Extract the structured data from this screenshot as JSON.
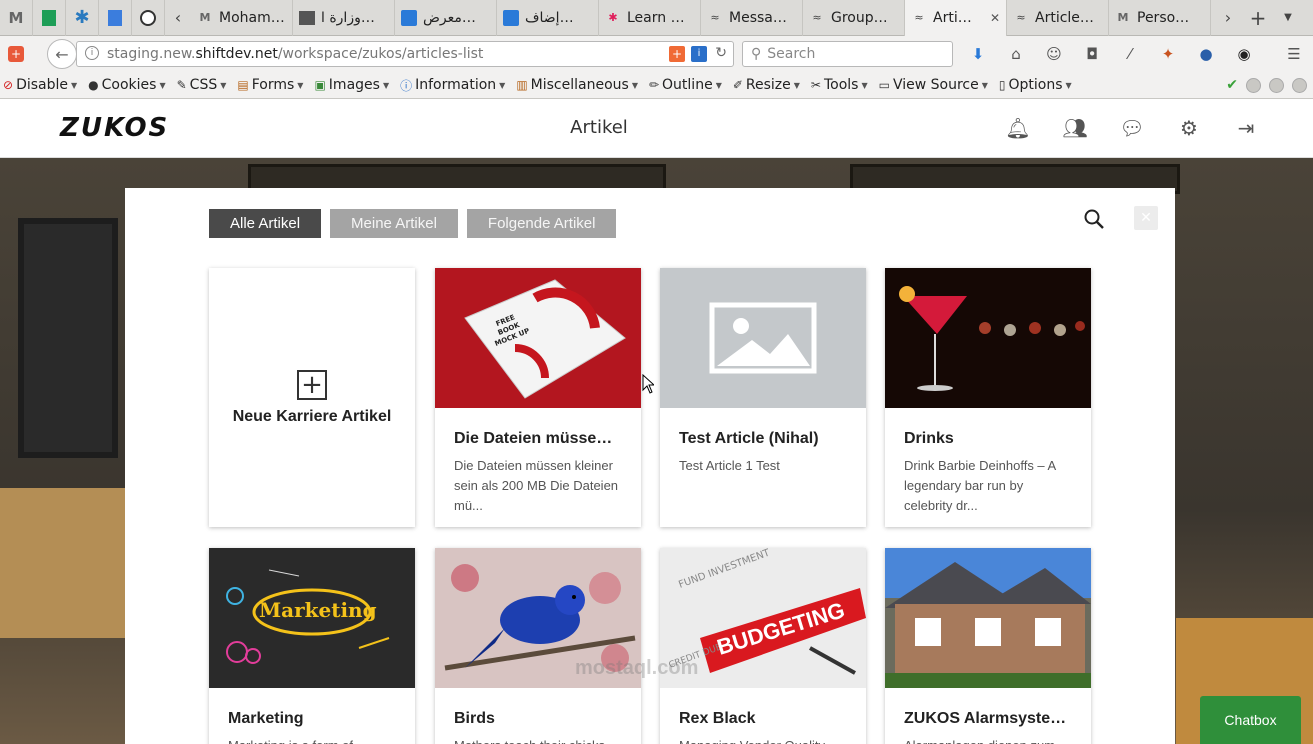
{
  "browser": {
    "tabs": [
      {
        "label": "Mohame…",
        "icon": "gmail-icon",
        "active": false
      },
      {
        "label": "وزارة ا…",
        "icon": "document-icon",
        "active": false
      },
      {
        "label": "معرض…",
        "icon": "mostaql-icon",
        "active": false
      },
      {
        "label": "إضاف…",
        "icon": "mostaql-icon",
        "active": false
      },
      {
        "label": "Learn …",
        "icon": "slack-icon",
        "active": false
      },
      {
        "label": "Messa…",
        "icon": "zukos-icon",
        "active": false
      },
      {
        "label": "Group…",
        "icon": "zukos-icon",
        "active": false
      },
      {
        "label": "Arti…",
        "icon": "zukos-icon",
        "active": true
      },
      {
        "label": "Article…",
        "icon": "zukos-icon",
        "active": false
      },
      {
        "label": "Perso…",
        "icon": "gmail-icon",
        "active": false
      }
    ],
    "url_prefix": "staging.new.",
    "url_domain": "shiftdev.net",
    "url_path": "/workspace/zukos/articles-list",
    "search_placeholder": "Search"
  },
  "devbar": {
    "items": [
      {
        "label": "Disable",
        "icon": "disable-icon"
      },
      {
        "label": "Cookies",
        "icon": "cookies-icon"
      },
      {
        "label": "CSS",
        "icon": "css-icon"
      },
      {
        "label": "Forms",
        "icon": "forms-icon"
      },
      {
        "label": "Images",
        "icon": "images-icon"
      },
      {
        "label": "Information",
        "icon": "information-icon"
      },
      {
        "label": "Miscellaneous",
        "icon": "miscellaneous-icon"
      },
      {
        "label": "Outline",
        "icon": "outline-icon"
      },
      {
        "label": "Resize",
        "icon": "resize-icon"
      },
      {
        "label": "Tools",
        "icon": "tools-icon"
      },
      {
        "label": "View Source",
        "icon": "view-source-icon"
      },
      {
        "label": "Options",
        "icon": "options-icon"
      }
    ]
  },
  "app": {
    "logo": "ZUKOS",
    "title": "Artikel"
  },
  "filters": {
    "all": "Alle Artikel",
    "mine": "Meine Artikel",
    "following": "Folgende Artikel"
  },
  "new_card": {
    "label": "Neue Karriere Artikel"
  },
  "articles": [
    {
      "title": "Die Dateien müssen …",
      "desc": "Die Dateien müssen kleiner sein als 200 MB Die Dateien mü...",
      "image": "book-mockup"
    },
    {
      "title": "Test Article (Nihal)",
      "desc": "Test Article 1 Test",
      "image": "placeholder"
    },
    {
      "title": "Drinks",
      "desc": "Drink Barbie Deinhoffs – A legendary bar run by celebrity dr...",
      "image": "cocktail"
    },
    {
      "title": "Marketing",
      "desc": "Marketing is a form of",
      "image": "marketing-chalkboard"
    },
    {
      "title": "Birds",
      "desc": "Mothers teach their chicks",
      "image": "blue-bird"
    },
    {
      "title": "Rex Black",
      "desc": "Managing Vendor Quality Risk",
      "image": "budgeting"
    },
    {
      "title": "ZUKOS Alarmsysteme",
      "desc": "Alarmanlagen dienen zum",
      "image": "house"
    }
  ],
  "book_text": "FREE BOOK MOCK UP",
  "marketing_text": "Marketing",
  "budget_text": "BUDGETING",
  "watermark": "mostaql.com",
  "chatbox": "Chatbox",
  "colors": {
    "filter_active": "#4a4a4a",
    "filter_inactive": "#a4a4a4",
    "chatbox": "#2f8f3a"
  }
}
